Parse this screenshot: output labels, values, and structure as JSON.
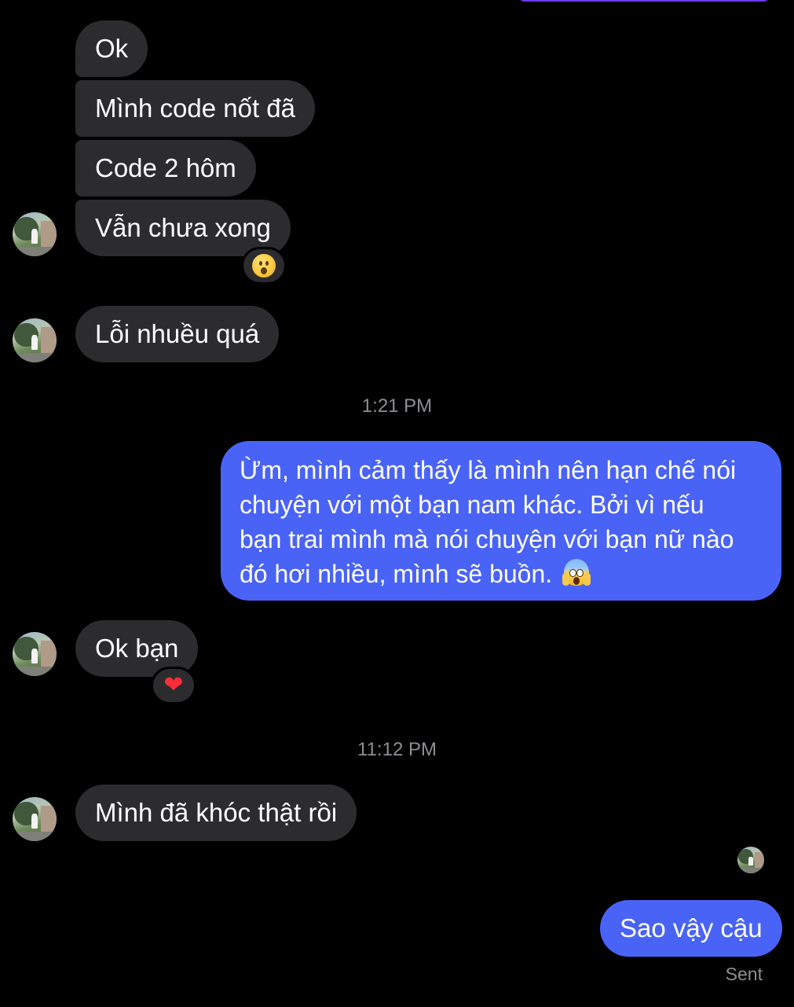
{
  "conversation": {
    "messages": [
      {
        "sender": "other",
        "text": "Ok"
      },
      {
        "sender": "other",
        "text": "Mình code nốt đã"
      },
      {
        "sender": "other",
        "text": "Code 2 hôm"
      },
      {
        "sender": "other",
        "text": "Vẫn chưa xong",
        "reaction": "wow-face"
      },
      {
        "sender": "other",
        "text": "Lỗi nhuều quá"
      },
      {
        "timestamp": "1:21 PM"
      },
      {
        "sender": "me",
        "lines": [
          "Ừm, mình cảm thấy là mình nên hạn chế nói",
          "chuyện với một bạn nam khác. Bởi vì nếu",
          "bạn trai mình mà nói chuyện với bạn nữ nào",
          "đó hơi nhiều, mình sẽ buồn."
        ],
        "emoji": "face-screaming-in-fear"
      },
      {
        "sender": "other",
        "text": "Ok bạn",
        "reaction": "red-heart"
      },
      {
        "timestamp": "11:12 PM"
      },
      {
        "sender": "other",
        "text": "Mình đã khóc thật rồi"
      },
      {
        "sender": "me",
        "text": "Sao vậy cậu",
        "status": "Sent"
      }
    ]
  },
  "reactions": {
    "heart_glyph": "❤"
  },
  "colors": {
    "background": "#000000",
    "incoming_bubble": "#2c2c2e",
    "outgoing_bubble": "#4a63f7",
    "meta_text": "#8e8e93"
  }
}
